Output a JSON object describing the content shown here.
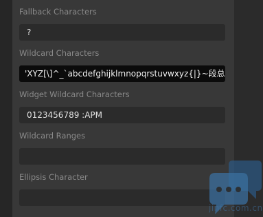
{
  "fields": [
    {
      "label": "Fallback Characters",
      "value": "?"
    },
    {
      "label": "Wildcard Characters",
      "value": "'XYZ[\\]^_`abcdefghijklmnopqrstuvwxyz{|}~段总输"
    },
    {
      "label": "Widget Wildcard Characters",
      "value": "0123456789 :APM"
    },
    {
      "label": "Wildcard Ranges",
      "value": ""
    },
    {
      "label": "Ellipsis Character",
      "value": ""
    }
  ],
  "watermark": {
    "text": "jinfc.com.cn"
  },
  "icons": {
    "chat": "chat-bubble-icon"
  },
  "colors": {
    "panel": "#383838",
    "input": "#2b2b2b",
    "input_active": "#0b0b0b",
    "label": "#8a8a8a",
    "value": "#e2e2e2",
    "watermark": "#3f6f9c"
  }
}
